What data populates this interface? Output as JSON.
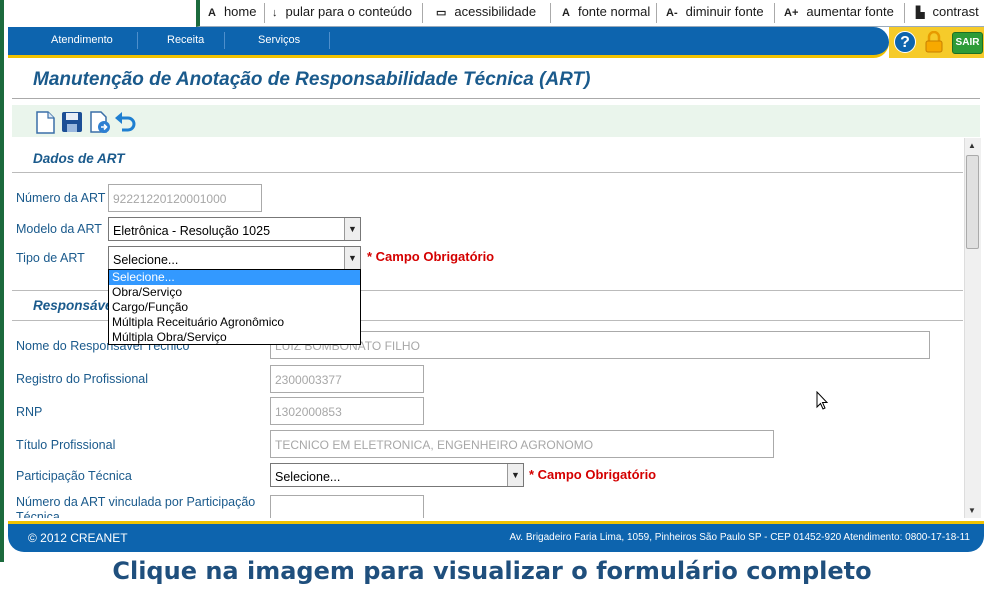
{
  "access_bar": {
    "home": "home",
    "skip": "pular para o conteúdo",
    "accessibility": "acessibilidade",
    "normal_font": "fonte normal",
    "decrease_font": "diminuir fonte",
    "increase_font": "aumentar fonte",
    "contrast": "contrast",
    "icons": {
      "home": "A",
      "skip": "↓",
      "accessibility": "▭",
      "normal_font": "A",
      "decrease_font": "A-",
      "increase_font": "A+",
      "contrast": "▙"
    }
  },
  "navbar": {
    "items": [
      "Atendimento",
      "Receita",
      "Serviços"
    ],
    "help": "?",
    "sair": "SAIR"
  },
  "page": {
    "title": "Manutenção de Anotação de Responsabilidade Técnica (ART)"
  },
  "toolbar": {
    "icons": [
      "new-document-icon",
      "save-icon",
      "export-icon",
      "undo-icon"
    ]
  },
  "form": {
    "section1": "Dados de ART",
    "numero_label": "Número da ART",
    "numero_value": "92221220120001000",
    "modelo_label": "Modelo da ART",
    "modelo_value": "Eletrônica - Resolução 1025",
    "tipo_label": "Tipo de ART",
    "tipo_value": "Selecione...",
    "required": "* Campo Obrigatório",
    "tipo_options": [
      "Selecione...",
      "Obra/Serviço",
      "Cargo/Função",
      "Múltipla Receituário Agronômico",
      "Múltipla Obra/Serviço"
    ],
    "section2": "Responsável",
    "nome_label": "Nome do Responsável Técnico",
    "nome_value": "LUIZ BOMBONATO FILHO",
    "registro_label": "Registro do Profissional",
    "registro_value": "2300003377",
    "rnp_label": "RNP",
    "rnp_value": "1302000853",
    "titulo_label": "Título Profissional",
    "titulo_value": "TECNICO EM ELETRONICA, ENGENHEIRO AGRONOMO",
    "participacao_label": "Participação Técnica",
    "participacao_value": "Selecione...",
    "vinculada_label": "Número da ART vinculada por Participação Técnica",
    "vinculada_value": ""
  },
  "footer": {
    "copyright": "© 2012 CREANET",
    "address": "Av. Brigadeiro Faria Lima, 1059, Pinheiros São Paulo SP - CEP 01452-920 Atendimento: 0800-17-18-11"
  },
  "caption": "Clique na imagem para visualizar o formulário completo",
  "colors": {
    "brand_blue": "#0d64ae",
    "accent_yellow": "#f2c200",
    "required_red": "#d40000",
    "label_blue": "#1a5a8c"
  }
}
